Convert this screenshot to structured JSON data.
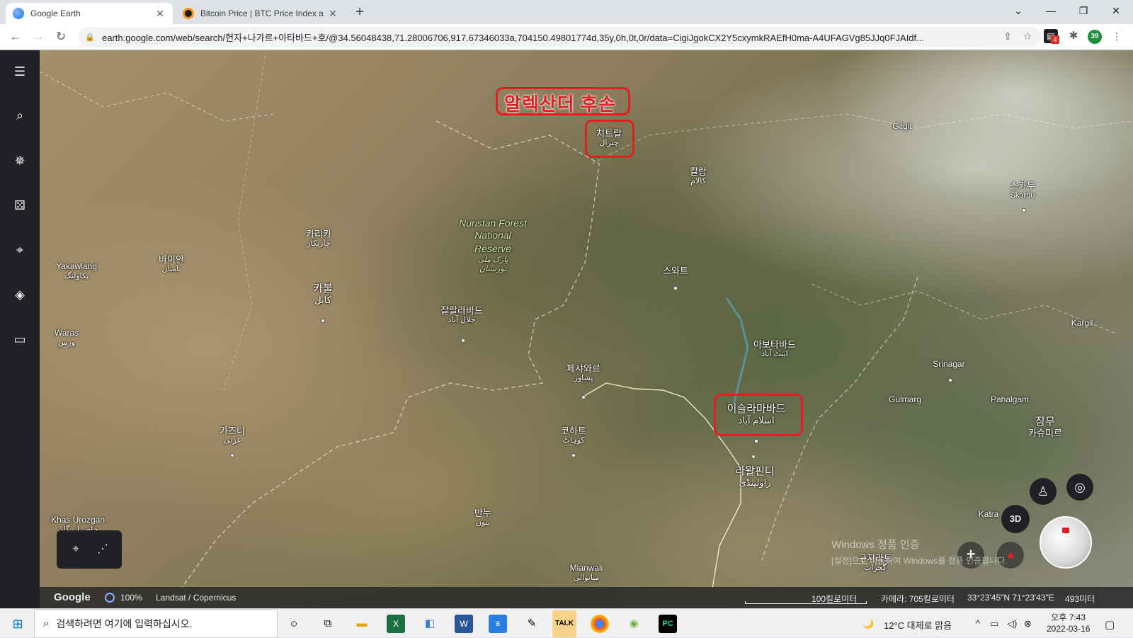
{
  "browser": {
    "tabs": [
      {
        "title": "Google Earth",
        "favicon_color": "#4285f4"
      },
      {
        "title": "Bitcoin Price | BTC Price Index a",
        "favicon_color": "#f7931a"
      }
    ],
    "url": "earth.google.com/web/search/헌자+나가르+아타바드+호/@34.56048438,71.28006706,917.67346033a,704150.49801774d,35y,0h,0t,0r/data=CigiJgokCX2Y5cxymkRAEfH0ma-A4UFAGVg85JJq0FJAIdf...",
    "extension_badge": "4",
    "profile_count": "39"
  },
  "map": {
    "annotation_title": "알렉산더 후손",
    "places": [
      {
        "name": "치트랄",
        "sub": "چترال"
      },
      {
        "name": "칼람",
        "sub": "کالام"
      },
      {
        "name": "Gilgit",
        "sub": ""
      },
      {
        "name": "스카두",
        "sub": "Skardu"
      },
      {
        "name": "Nuristan Forest",
        "sub": "National"
      },
      {
        "name": "Reserve",
        "sub": ""
      },
      {
        "name": "پارک ملی",
        "sub": "نورستان"
      },
      {
        "name": "카리카",
        "sub": "چاریکار"
      },
      {
        "name": "바미안",
        "sub": "بامیان"
      },
      {
        "name": "Yakawlang",
        "sub": "یکاولنگ"
      },
      {
        "name": "카불",
        "sub": "کابل"
      },
      {
        "name": "스와트",
        "sub": ""
      },
      {
        "name": "잘랄라바드",
        "sub": "جلال آباد"
      },
      {
        "name": "Waras",
        "sub": "ورس"
      },
      {
        "name": "아보타바드",
        "sub": "ایبٹ آباد"
      },
      {
        "name": "Kargil",
        "sub": ""
      },
      {
        "name": "페샤와르",
        "sub": "پشاور"
      },
      {
        "name": "Srinagar",
        "sub": ""
      },
      {
        "name": "이슬라마바드",
        "sub": "اسلام آباد"
      },
      {
        "name": "Gulmarg",
        "sub": ""
      },
      {
        "name": "Pahalgam",
        "sub": ""
      },
      {
        "name": "잠무",
        "sub": "카슈미르"
      },
      {
        "name": "가즈니",
        "sub": "غزنی"
      },
      {
        "name": "코하트",
        "sub": "کوہاٹ"
      },
      {
        "name": "라왈핀디",
        "sub": "راولپنڈی"
      },
      {
        "name": "Katra",
        "sub": ""
      },
      {
        "name": "Khas Urozgan",
        "sub": "خاص ارزگان"
      },
      {
        "name": "반누",
        "sub": "بنوں"
      },
      {
        "name": "구지라트",
        "sub": "گجرات"
      },
      {
        "name": "Mianwali",
        "sub": "میانوالی"
      }
    ],
    "controls": {
      "view_3d": "3D",
      "zoom_in": "+"
    }
  },
  "watermark": {
    "line1": "Windows 정품 인증",
    "line2": "[설정]으로 이동하여 Windows를 정품 인증합니다."
  },
  "statusbar": {
    "logo": "Google",
    "loading": "100%",
    "source": "Landsat / Copernicus",
    "scale": "100킬로미터",
    "camera": "카메라: 705킬로미터",
    "coords": "33°23'45\"N 71°23'43\"E",
    "elevation": "493미터"
  },
  "taskbar": {
    "search_placeholder": "검색하려면 여기에 입력하십시오.",
    "weather": "12°C  대체로 맑음",
    "time": "오후 7:43",
    "date": "2022-03-16"
  }
}
